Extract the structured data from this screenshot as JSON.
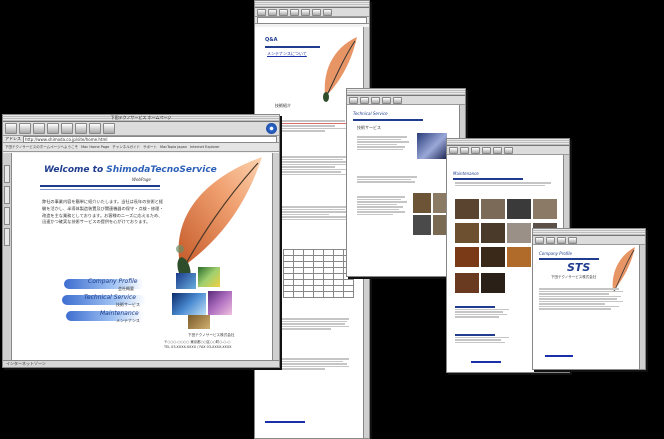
{
  "main_window": {
    "title": "下田テクノサービス ホームページ",
    "address_label": "アドレス",
    "url": "http://www.shimoda.co.jp/site/home.html",
    "favorites": [
      "下田テクノサービスのホームページへようこそ",
      "Mac Home Page",
      "チャンネルガイド",
      "サポート",
      "MacTopia Japan",
      "Internet Explorer"
    ],
    "status": "インターネットゾーン",
    "welcome_prefix": "Welcome to ",
    "welcome_brand": "ShimodaTecnoService",
    "webpage_label": "WebPage",
    "intro": "弊社の事業内容を簡単に紹介いたします。当社は長年の技術と経験を活かし、半導体製造装置及び関連機器の保守・点検・修理・改造を主な業務としております。お客様のニーズに応えるため、迅速かつ確実な技術サービスの提供を心がけております。",
    "menu": [
      {
        "en": "Company Profile",
        "jp": "会社概要"
      },
      {
        "en": "Technical Service",
        "jp": "技術サービス"
      },
      {
        "en": "Maintenance",
        "jp": "メンテナンス"
      }
    ],
    "footer_company": "下田テクノサービス株式会社",
    "footer_address": "〒○○○-○○○○ 東京都○○区○○町○-○-○",
    "footer_contact": "TEL 03-XXXX-XXXX / FAX 03-XXXX-XXXX"
  },
  "qa_window": {
    "heading": "Q&A",
    "link": "メンテナンスについて",
    "section": "技術紹介"
  },
  "tech_window": {
    "heading": "Technical Service",
    "title": "技術サービス"
  },
  "maint_window": {
    "heading": "Maintenance",
    "sub": "メンテナンス"
  },
  "profile_window": {
    "heading": "Company Profile",
    "logo": "STS",
    "company": "下田テクノサービス株式会社",
    "sub": "会社概要"
  },
  "colors": {
    "accent": "#1f3c8f",
    "feather": "#e58a55",
    "link": "#1a2fa8"
  }
}
